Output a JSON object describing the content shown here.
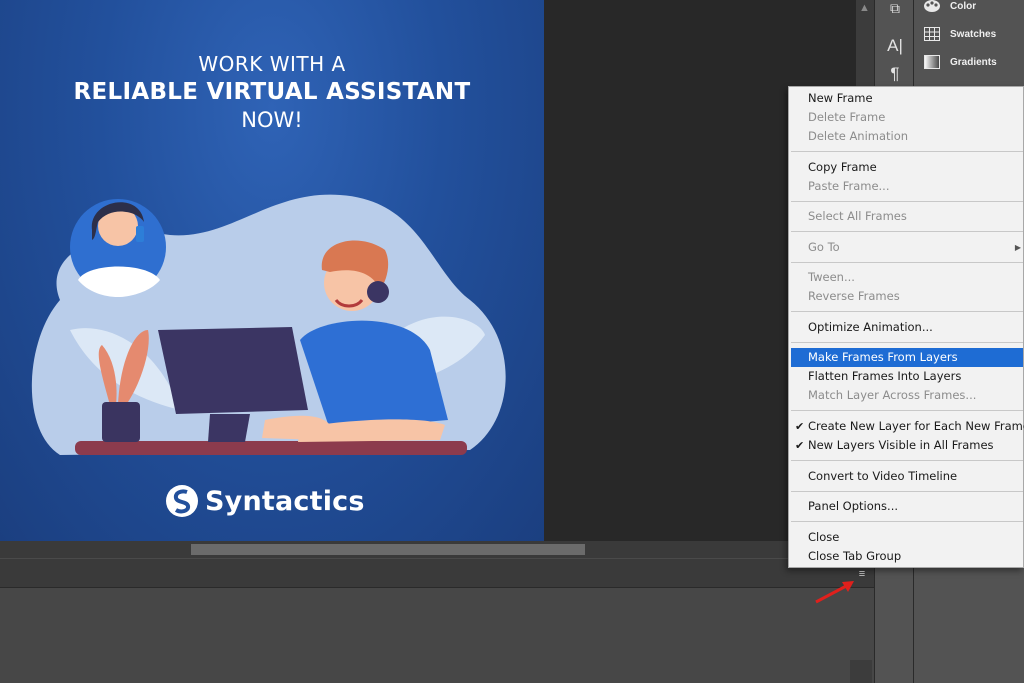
{
  "artwork": {
    "headline_line1": "WORK WITH A",
    "headline_line2": "RELIABLE VIRTUAL ASSISTANT",
    "headline_line3": "NOW!",
    "brand_name": "Syntactics"
  },
  "panels": [
    {
      "label": "Color",
      "icon": "palette-icon"
    },
    {
      "label": "Swatches",
      "icon": "swatches-grid-icon"
    },
    {
      "label": "Gradients",
      "icon": "gradient-icon"
    }
  ],
  "tools": [
    {
      "icon": "history-brush-icon",
      "glyph": "⧉"
    },
    {
      "icon": "character-icon",
      "glyph": "A|"
    },
    {
      "icon": "paragraph-icon",
      "glyph": "¶"
    }
  ],
  "context_menu": {
    "items": [
      {
        "label": "New Frame",
        "enabled": true
      },
      {
        "label": "Delete Frame",
        "enabled": false
      },
      {
        "label": "Delete Animation",
        "enabled": false
      },
      {
        "label": "Copy Frame",
        "enabled": true
      },
      {
        "label": "Paste Frame...",
        "enabled": false
      },
      {
        "label": "Select All Frames",
        "enabled": false
      },
      {
        "label": "Go To",
        "enabled": false,
        "submenu": true
      },
      {
        "label": "Tween...",
        "enabled": false
      },
      {
        "label": "Reverse Frames",
        "enabled": false
      },
      {
        "label": "Optimize Animation...",
        "enabled": true
      },
      {
        "label": "Make Frames From Layers",
        "enabled": true,
        "highlighted": true
      },
      {
        "label": "Flatten Frames Into Layers",
        "enabled": true
      },
      {
        "label": "Match Layer Across Frames...",
        "enabled": false
      },
      {
        "label": "Create New Layer for Each New Frame",
        "enabled": true,
        "checked": true
      },
      {
        "label": "New Layers Visible in All Frames",
        "enabled": true,
        "checked": true
      },
      {
        "label": "Convert to Video Timeline",
        "enabled": true
      },
      {
        "label": "Panel Options...",
        "enabled": true
      },
      {
        "label": "Close",
        "enabled": true
      },
      {
        "label": "Close Tab Group",
        "enabled": true
      }
    ]
  },
  "colors": {
    "menu_highlight": "#1e6cd4",
    "canvas_blue": "#22509c",
    "annotation_arrow": "#e0201c"
  }
}
